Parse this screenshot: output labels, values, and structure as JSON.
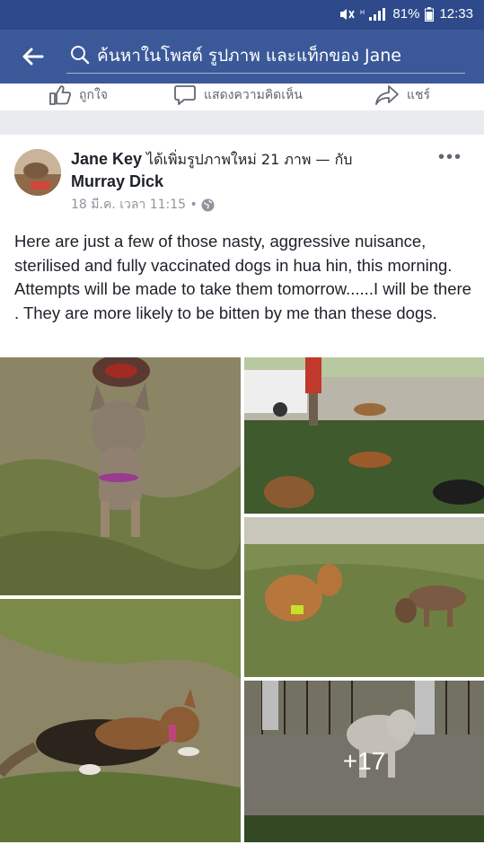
{
  "status": {
    "battery": "81%",
    "time": "12:33"
  },
  "search": {
    "placeholder": "ค้นหาในโพสต์ รูปภาพ และแท็กของ Jane"
  },
  "actions": {
    "like": "ถูกใจ",
    "comment": "แสดงความคิดเห็น",
    "share": "แชร์"
  },
  "post": {
    "author": "Jane Key",
    "action": "ได้เพิ่มรูปภาพใหม่ 21 ภาพ — กับ",
    "tagged": "Murray Dick",
    "date": "18 มี.ค. เวลา 11:15 •",
    "body": "Here are just a few of those nasty, aggressive nuisance, sterilised and fully vaccinated dogs in hua hin, this morning. Attempts will be made to take them tomorrow......I will be there . They are more likely to be bitten by me than these dogs.",
    "more_photos": "+17"
  },
  "colors": {
    "brand": "#3b5998",
    "statusbar": "#2e4a8b",
    "text": "#1d2129",
    "meta": "#90949c"
  },
  "icons": [
    "back-arrow-icon",
    "search-icon",
    "like-icon",
    "comment-icon",
    "share-icon",
    "globe-icon",
    "more-icon"
  ]
}
